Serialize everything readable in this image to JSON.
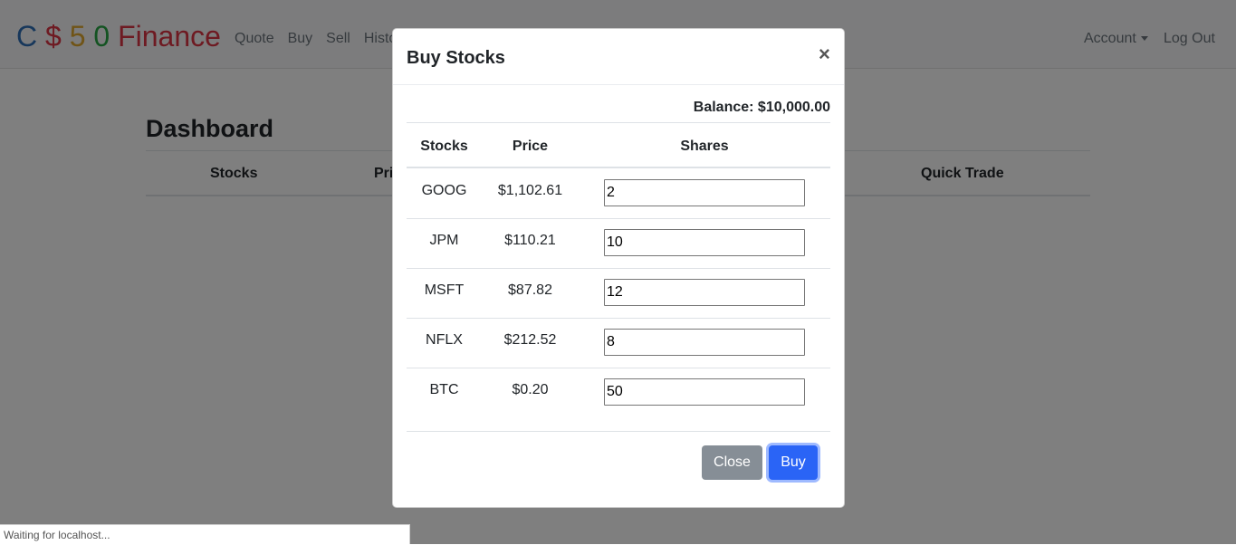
{
  "brand": {
    "parts": [
      "C",
      "$",
      "5",
      "0",
      "Finance"
    ]
  },
  "nav": {
    "links": [
      "Quote",
      "Buy",
      "Sell",
      "Histo"
    ],
    "account": "Account",
    "logout": "Log Out"
  },
  "dashboard": {
    "title": "Dashboard",
    "headers": [
      "Stocks",
      "Pri",
      "Quick Trade"
    ]
  },
  "modal": {
    "title": "Buy Stocks",
    "close_symbol": "×",
    "balance": "Balance: $10,000.00",
    "columns": [
      "Stocks",
      "Price",
      "Shares"
    ],
    "rows": [
      {
        "symbol": "GOOG",
        "price": "$1,102.61",
        "shares": "2"
      },
      {
        "symbol": "JPM",
        "price": "$110.21",
        "shares": "10"
      },
      {
        "symbol": "MSFT",
        "price": "$87.82",
        "shares": "12"
      },
      {
        "symbol": "NFLX",
        "price": "$212.52",
        "shares": "8"
      },
      {
        "symbol": "BTC",
        "price": "$0.20",
        "shares": "50"
      }
    ],
    "close_label": "Close",
    "buy_label": "Buy"
  },
  "status": {
    "text": "Waiting for localhost..."
  },
  "colors": {
    "buy_button": "#2a64f6",
    "close_button": "#868e96",
    "backdrop": "rgba(0,0,0,0.5)"
  }
}
